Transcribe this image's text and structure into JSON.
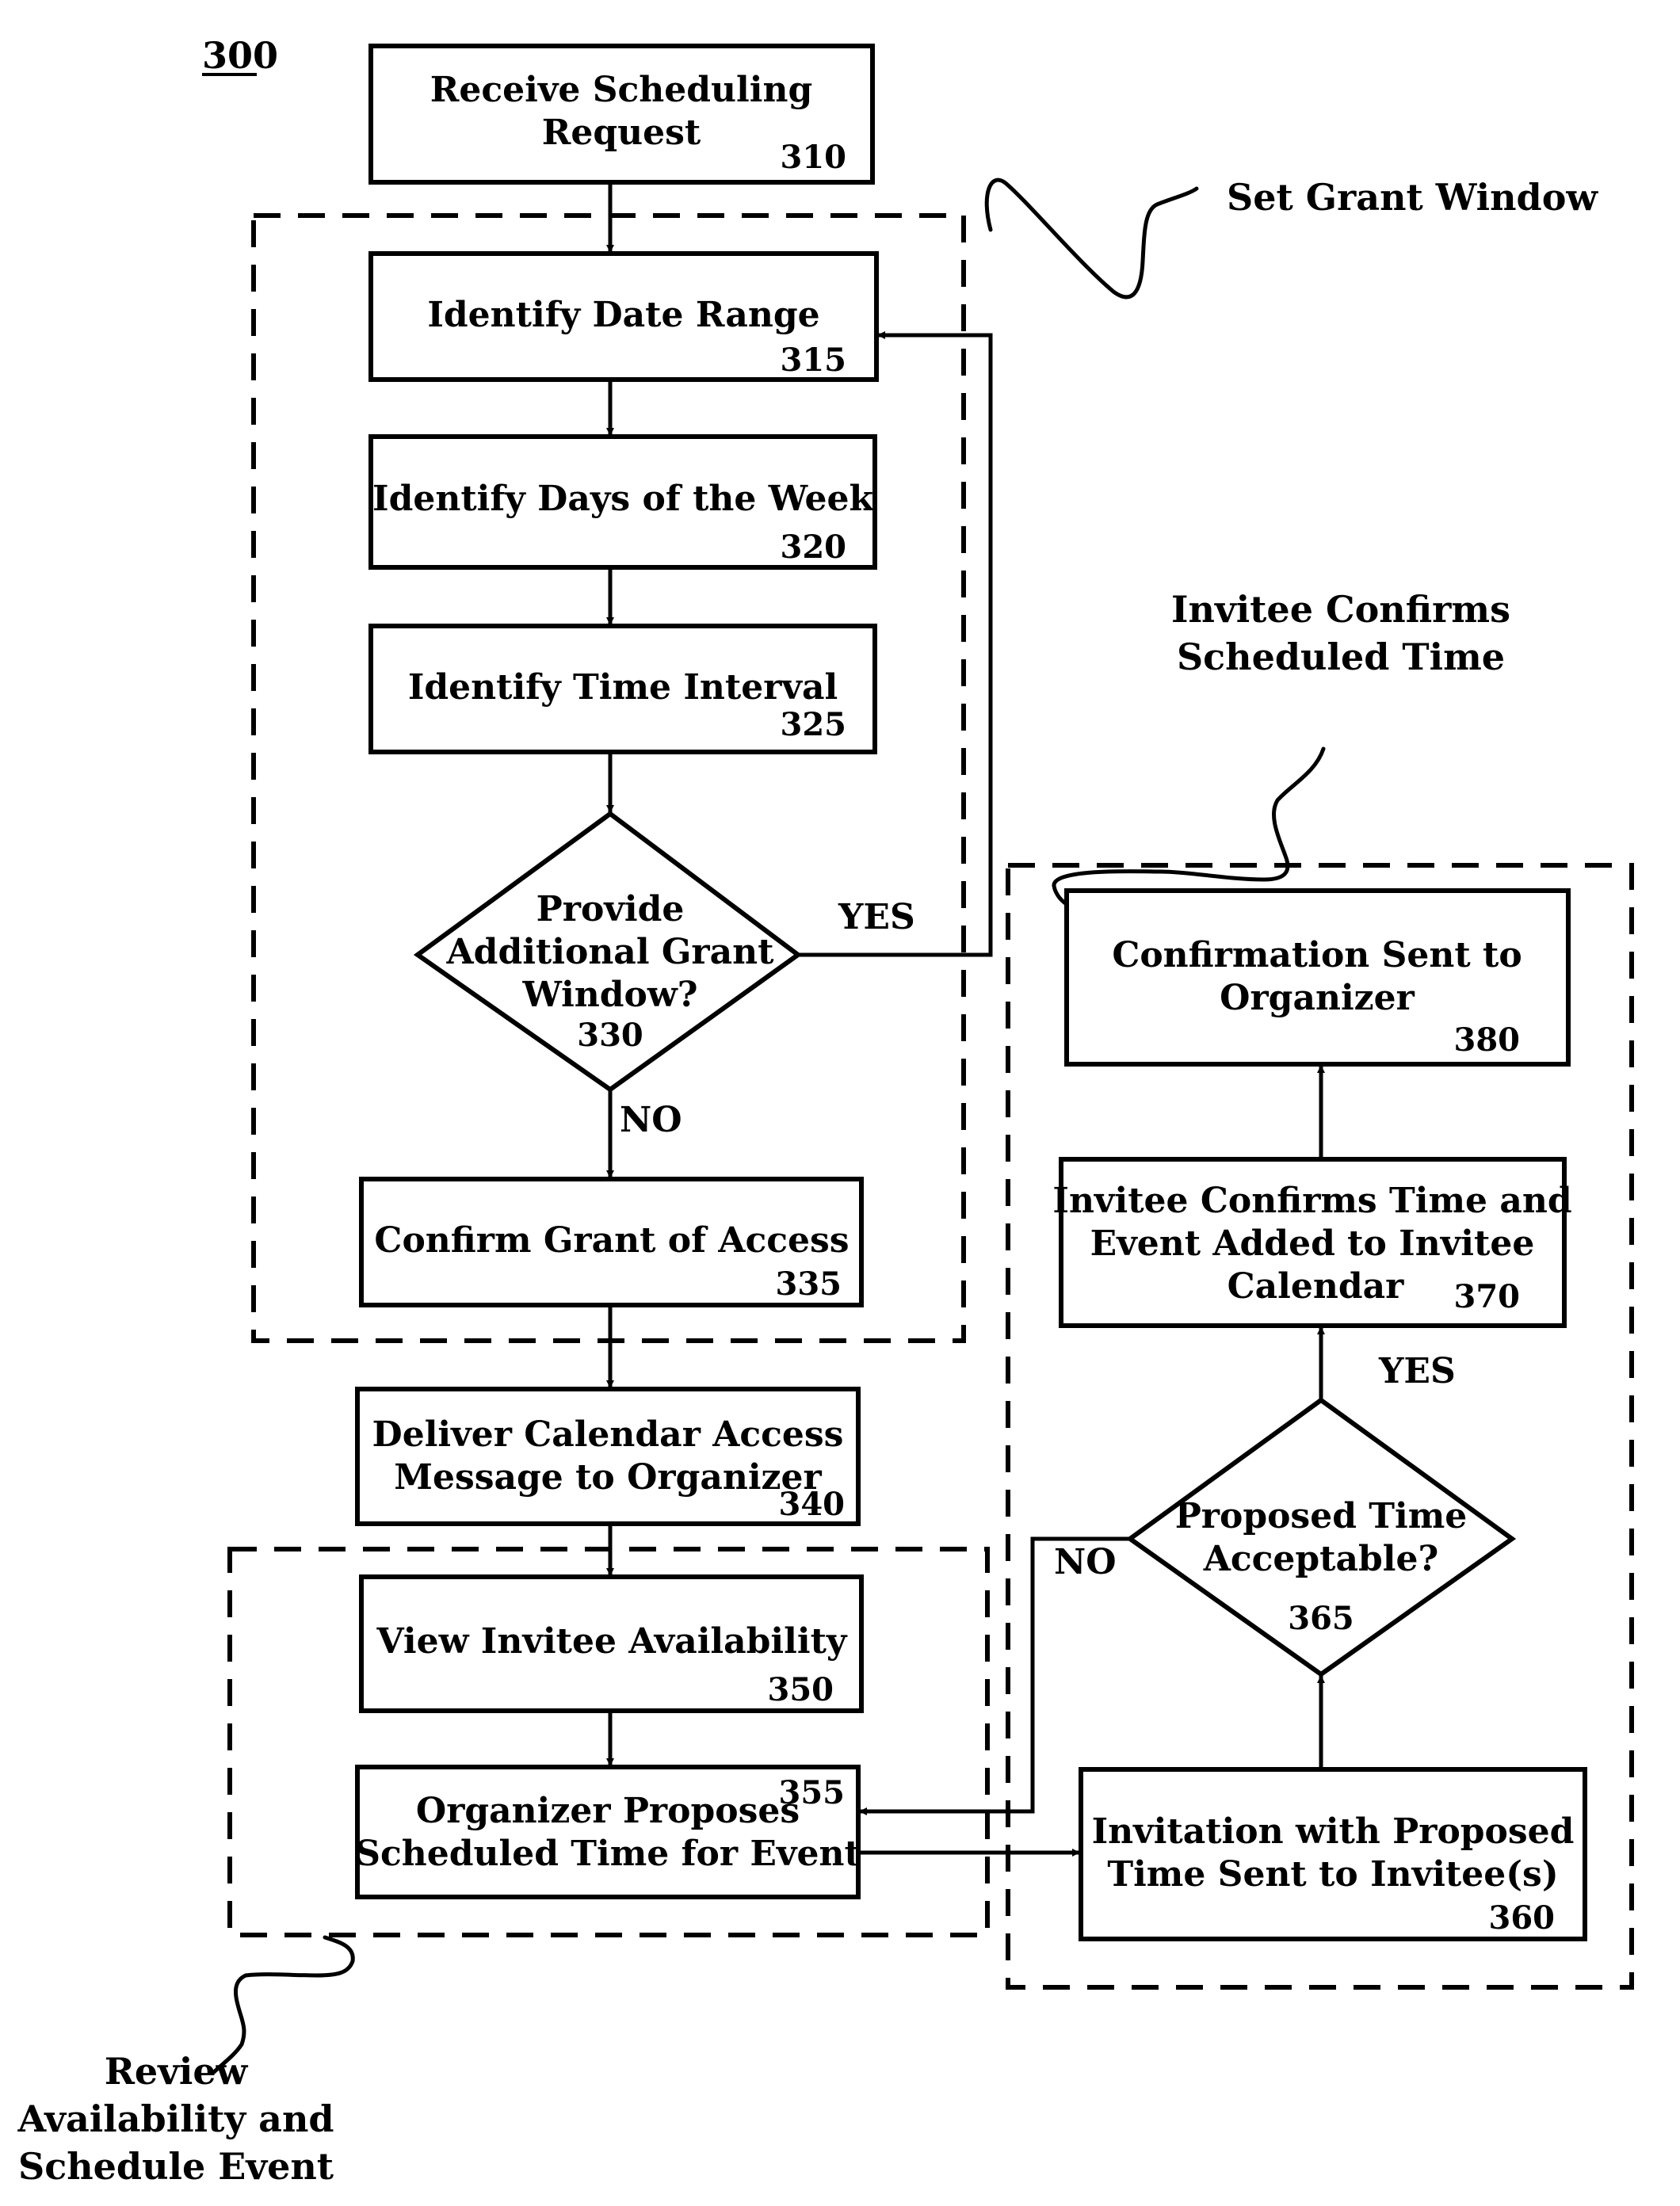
{
  "figure": {
    "ref": "300"
  },
  "steps": {
    "s310": {
      "lines": [
        "Receive Scheduling",
        "Request"
      ],
      "ref": "310"
    },
    "s315": {
      "lines": [
        "Identify Date Range"
      ],
      "ref": "315"
    },
    "s320": {
      "lines": [
        "Identify Days of the Week"
      ],
      "ref": "320"
    },
    "s325": {
      "lines": [
        "Identify Time Interval"
      ],
      "ref": "325"
    },
    "s330": {
      "lines": [
        "Provide",
        "Additional Grant",
        "Window?"
      ],
      "ref": "330"
    },
    "s335": {
      "lines": [
        "Confirm Grant of Access"
      ],
      "ref": "335"
    },
    "s340": {
      "lines": [
        "Deliver Calendar Access",
        "Message to Organizer"
      ],
      "ref": "340"
    },
    "s350": {
      "lines": [
        "View Invitee Availability"
      ],
      "ref": "350"
    },
    "s355": {
      "lines": [
        "Organizer Proposes",
        "Scheduled Time for Event"
      ],
      "ref": "355"
    },
    "s360": {
      "lines": [
        "Invitation with Proposed",
        "Time Sent to Invitee(s)"
      ],
      "ref": "360"
    },
    "s365": {
      "lines": [
        "Proposed Time",
        "Acceptable?"
      ],
      "ref": "365"
    },
    "s370": {
      "lines": [
        "Invitee Confirms Time and",
        "Event Added to Invitee",
        "Calendar"
      ],
      "ref": "370"
    },
    "s380": {
      "lines": [
        "Confirmation Sent to",
        "Organizer"
      ],
      "ref": "380"
    }
  },
  "branches": {
    "b330_yes": "YES",
    "b330_no": "NO",
    "b365_yes": "YES",
    "b365_no": "NO"
  },
  "groups": {
    "set_grant_window": {
      "lines": [
        "Set Grant Window"
      ]
    },
    "invitee_confirms": {
      "lines": [
        "Invitee Confirms",
        "Scheduled Time"
      ]
    },
    "review_schedule": {
      "lines": [
        "Review",
        "Availability and",
        "Schedule Event"
      ]
    }
  }
}
